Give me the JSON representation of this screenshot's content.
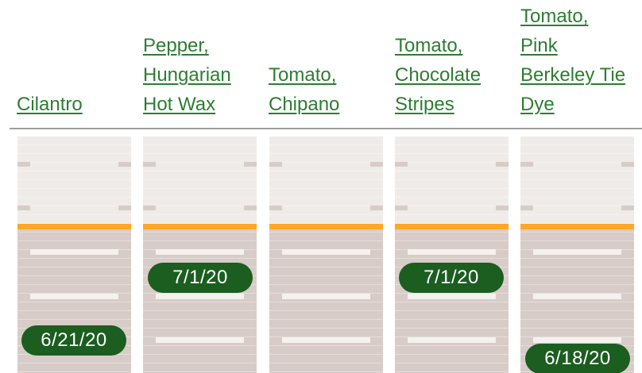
{
  "columns": [
    {
      "title": "Cilantro",
      "date": "6/21/20"
    },
    {
      "title": "Pepper,\nHungarian\nHot Wax",
      "date": "7/1/20"
    },
    {
      "title": "Tomato,\nChipano",
      "date": ""
    },
    {
      "title": "Tomato,\nChocolate\nStripes",
      "date": "7/1/20"
    },
    {
      "title": "Tomato,\nPink\nBerkeley Tie\nDye",
      "date": "6/18/20"
    }
  ],
  "colors": {
    "link": "#2e7d32",
    "badge": "#1b5e20",
    "today_line": "#ffa726",
    "past_area": "#efebe8",
    "future_area": "#d7ccc8"
  }
}
